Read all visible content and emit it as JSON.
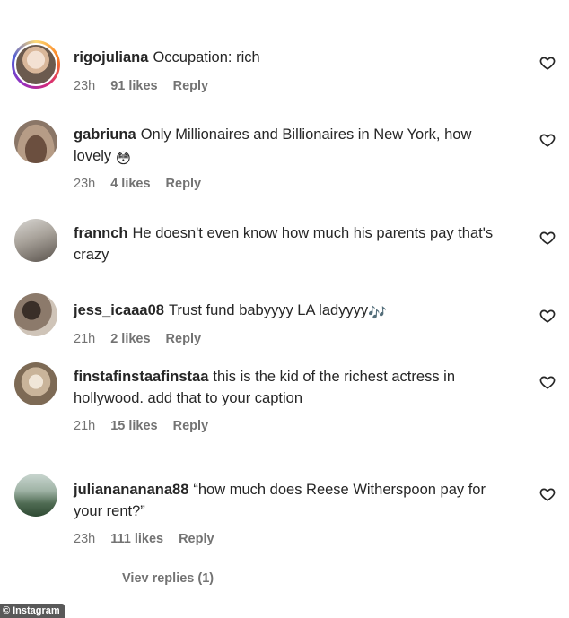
{
  "comments": [
    {
      "username": "rigojuliana",
      "text": "Occupation: rich",
      "time": "23h",
      "likes": "91 likes",
      "reply": "Reply"
    },
    {
      "username": "gabriuna",
      "text": "Only Millionaires and Billionaires in New York, how lovely",
      "emoji": "😳",
      "time": "23h",
      "likes": "4 likes",
      "reply": "Reply"
    },
    {
      "username": "frannch",
      "text": "He doesn't even know how much his parents pay that's crazy"
    },
    {
      "username": "jess_icaaa08",
      "text": "Trust fund babyyyy LA ladyyyy",
      "emoji": "🎶",
      "time": "21h",
      "likes": "2 likes",
      "reply": "Reply"
    },
    {
      "username": "finstafinstaafinstaa",
      "text": "this is the kid of the richest actress in hollywood. add that to your caption",
      "time": "21h",
      "likes": "15 likes",
      "reply": "Reply"
    },
    {
      "username": "julianananana88",
      "text": "“how much does Reese Witherspoon pay for your rent?”",
      "time": "23h",
      "likes": "111 likes",
      "reply": "Reply"
    }
  ],
  "view_replies": "Viev  replies (1)",
  "watermark": "Instagram",
  "watermark_symbol": "©",
  "icons": {
    "like": "heart-outline-icon"
  }
}
